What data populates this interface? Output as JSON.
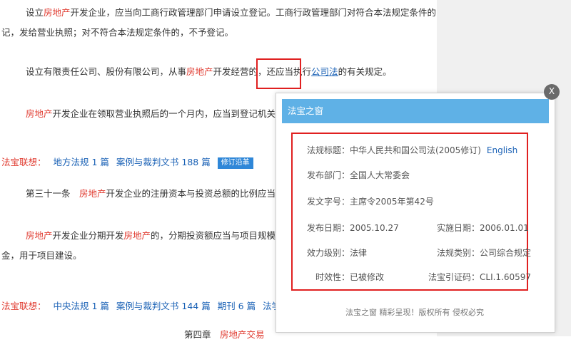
{
  "article": {
    "para1_line1_pre": "设立",
    "para1_line1_red": "房地产",
    "para1_line1_post": "开发企业，应当向工商行政管理部门申请设立登记。工商行政管理部门对符合本法规定条件的，应当予以登",
    "para1_line2": "记，发给营业执照；对不符合本法规定条件的，不予登记。",
    "para2_pre": "设立有限责任公司、股份有限公司，从事",
    "para2_red": "房地产",
    "para2_mid": "开发经营的，还应当执行",
    "para2_link": "公司法",
    "para2_post": "的有关规定。",
    "para3_red": "房地产",
    "para3_post": "开发企业在领取营业执照后的一个月内，应当到登记机关所在地的县",
    "assoc1": {
      "label": "法宝联想：",
      "items": [
        "地方法规 1 篇",
        "案例与裁判文书 188 篇"
      ],
      "badge": "修订沿革"
    },
    "para4_pre": "第三十一条　",
    "para4_red": "房地产",
    "para4_post": "开发企业的注册资本与投资总额的比例应当符合国家有",
    "para5_red1": "房地产",
    "para5_mid": "开发企业分期开发",
    "para5_red2": "房地产",
    "para5_post": "的，分期投资额应当与项目规模相适应，并",
    "para5_line2": "金，用于项目建设。",
    "assoc2": {
      "label": "法宝联想：",
      "items": [
        "中央法规 1 篇",
        "案例与裁判文书 144 篇",
        "期刊 6 篇",
        "法学文献 1 篇"
      ]
    },
    "para6_pre": "第四章　",
    "para6_red": "房地产交易"
  },
  "popup": {
    "title": "法宝之窗",
    "close": "X",
    "rows": {
      "law_title_label": "法规标题：",
      "law_title_value": "中华人民共和国公司法(2005修订)",
      "law_title_en": "English",
      "dept_label": "发布部门：",
      "dept_value": "全国人大常委会",
      "doc_no_label": "发文字号：",
      "doc_no_value": "主席令2005年第42号",
      "issue_date_label": "发布日期：",
      "issue_date_value": "2005.10.27",
      "effective_date_label": "实施日期：",
      "effective_date_value": "2006.01.01",
      "level_label": "效力级别：",
      "level_value": "法律",
      "category_label": "法规类别：",
      "category_value": "公司综合规定",
      "timeliness_label": "时效性：",
      "timeliness_value": "已被修改",
      "cite_label": "法宝引证码：",
      "cite_value": "CLI.1.60597"
    },
    "footer": "法宝之窗 精彩呈现！版权所有 侵权必究"
  }
}
